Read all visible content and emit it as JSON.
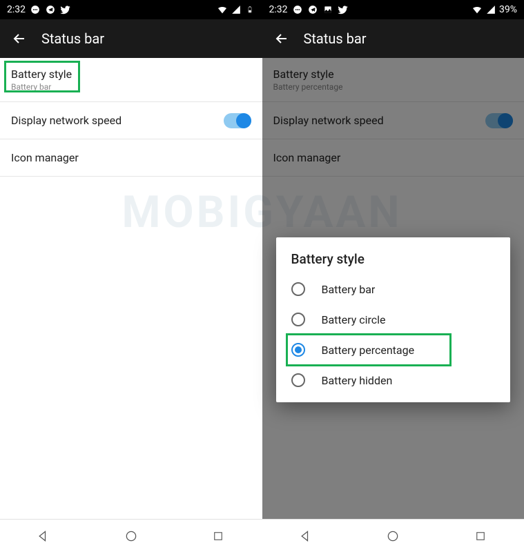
{
  "watermark": "MOBIGYAAN",
  "left": {
    "statusbar": {
      "time": "2:32"
    },
    "header": {
      "title": "Status bar"
    },
    "items": [
      {
        "title": "Battery style",
        "sub": "Battery bar"
      },
      {
        "title": "Display network speed",
        "switch": true
      },
      {
        "title": "Icon manager"
      }
    ]
  },
  "right": {
    "statusbar": {
      "time": "2:32",
      "battery_pct": "39%"
    },
    "header": {
      "title": "Status bar"
    },
    "items": [
      {
        "title": "Battery style",
        "sub": "Battery percentage"
      },
      {
        "title": "Display network speed",
        "switch": true
      },
      {
        "title": "Icon manager"
      }
    ],
    "dialog": {
      "title": "Battery style",
      "options": [
        {
          "label": "Battery bar",
          "checked": false
        },
        {
          "label": "Battery circle",
          "checked": false
        },
        {
          "label": "Battery percentage",
          "checked": true
        },
        {
          "label": "Battery hidden",
          "checked": false
        }
      ]
    }
  }
}
